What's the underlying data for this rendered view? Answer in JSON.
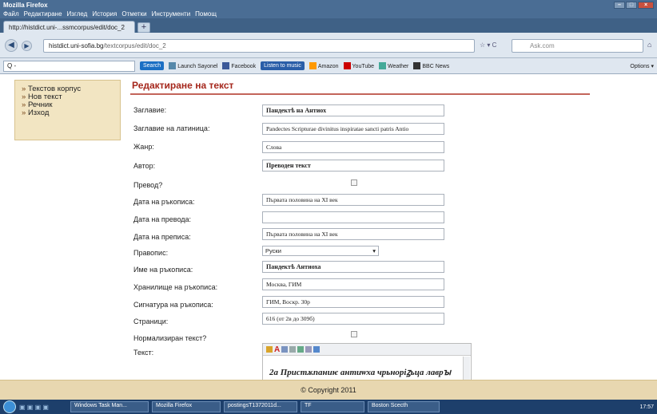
{
  "window": {
    "title": "Mozilla Firefox"
  },
  "menu": [
    "Файл",
    "Редактиране",
    "Изглед",
    "История",
    "Отметки",
    "Инструменти",
    "Помощ"
  ],
  "tab": {
    "label": "http://histdict.uni-...ssmcorpus/edit/doc_2",
    "new_tab": "+"
  },
  "nav": {
    "url_host": "histdict.uni-sofia.bg",
    "url_path": "/textcorpus/edit/doc_2",
    "search_placeholder": "Ask.com"
  },
  "toolbar": {
    "search_placeholder": "Q -",
    "search_button": "Search",
    "items": [
      "Launch Sayonel",
      "Facebook",
      "Listen to music",
      "Amazon",
      "YouTube",
      "Weather",
      "BBC News",
      "Options"
    ]
  },
  "sidebar": {
    "items": [
      "Текстов корпус",
      "Нов текст",
      "Речник",
      "Изход"
    ]
  },
  "form": {
    "title": "Редактиране на текст",
    "fields": [
      {
        "label": "Заглавие:",
        "value": "Пандектѣ на Антиох"
      },
      {
        "label": "Заглавие на латиница:",
        "value": "Pandectes Scripturae divinitus inspiratae sancti patris Antio"
      },
      {
        "label": "Жанр:",
        "value": "Слова"
      },
      {
        "label": "Автор:",
        "value": "Преводен текст"
      },
      {
        "label": "Превод?",
        "value": ""
      },
      {
        "label": "Дата на ръкописа:",
        "value": "Първата половина на XI век"
      },
      {
        "label": "Дата на превода:",
        "value": ""
      },
      {
        "label": "Дата на преписа:",
        "value": "Първата половина на XI век"
      },
      {
        "label": "Правопис:",
        "value": "Руски"
      },
      {
        "label": "Име на ръкописа:",
        "value": "Пандектѣ Антиоха"
      },
      {
        "label": "Хранилище на ръкописа:",
        "value": "Москва, ГИМ"
      },
      {
        "label": "Сигнатура на ръкописа:",
        "value": "ГИМ, Воскр. 30р"
      },
      {
        "label": "Страници:",
        "value": "616 (от 2в до 309б)"
      },
      {
        "label": "Нормализиран текст?",
        "value": ""
      },
      {
        "label": "Текст:",
        "value": "2а Пристѫпаниѥ антиѡха чрьнорiꙁьца лаврꙑ"
      }
    ]
  },
  "footer": {
    "copyright": "© Copyright 2011"
  },
  "taskbar": {
    "tasks": [
      "Windows Task Man...",
      "Mozilla Firefox",
      "postingsT1372011d...",
      "TF",
      "Boston Scecth"
    ],
    "clock": "17:57"
  },
  "colors": {
    "title_red": "#a5271c",
    "sidebar_bg": "#f2e5c2",
    "footer_bg": "#e8d7b0",
    "window_blue": "#4a6d94"
  }
}
